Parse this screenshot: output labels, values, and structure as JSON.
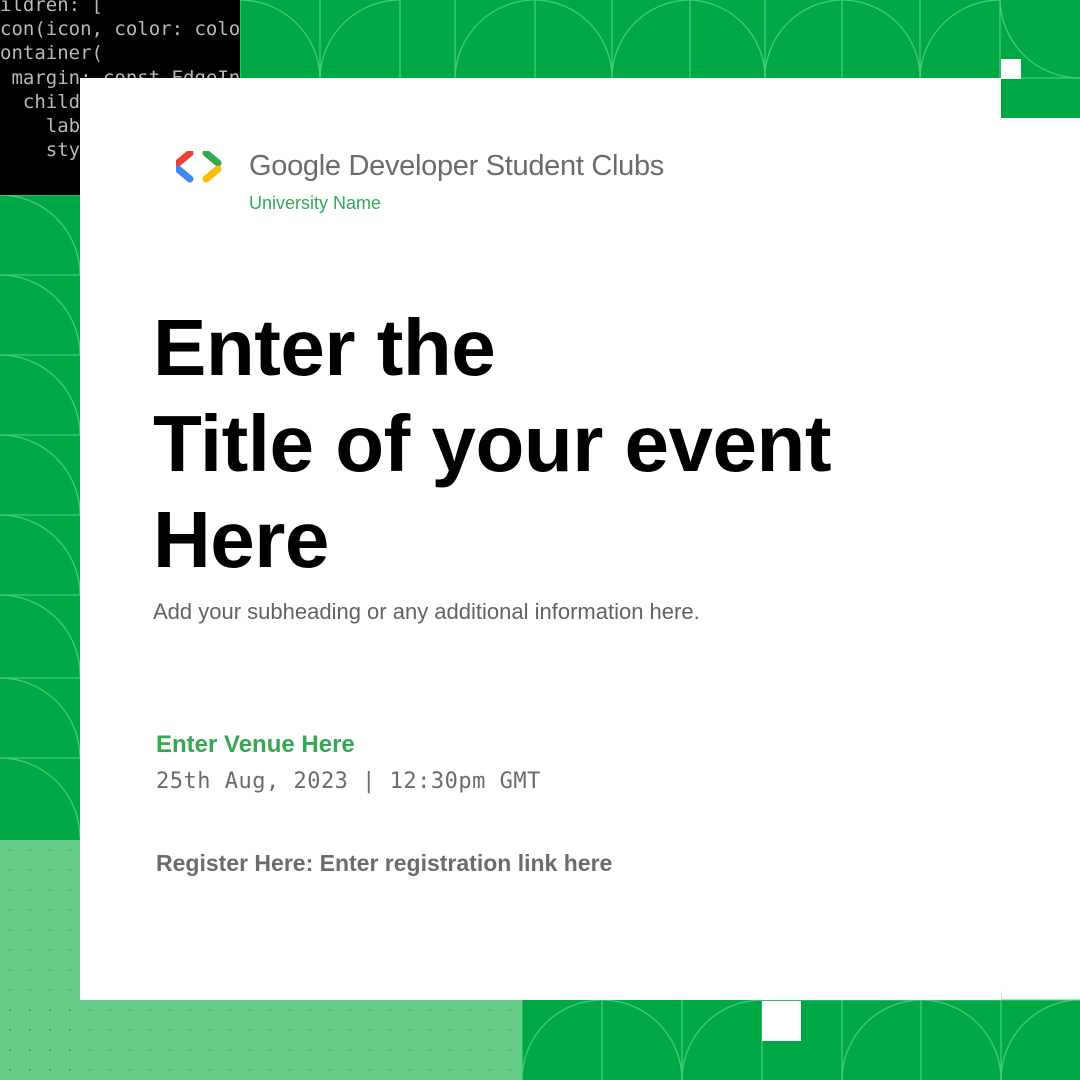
{
  "colors": {
    "brand_green": "#00a745",
    "light_green": "#66cc8a",
    "accent_green": "#34a853",
    "text_black": "#000000",
    "text_gray": "#5f6368",
    "logo_blue": "#4285f4",
    "logo_red": "#ea4335",
    "logo_green": "#34a853",
    "logo_yellow": "#fbbc04"
  },
  "code_snippet": [
    "ildren: [",
    "con(icon, color: color",
    "ontainer(",
    " margin: const EdgeIns",
    "  child:",
    "    label",
    "    style"
  ],
  "logo": {
    "icon": "gdsc-brackets-icon",
    "name": "Google Developer Student Clubs",
    "university": "University Name"
  },
  "event": {
    "title_lines": [
      "Enter the",
      "Title of your event",
      "Here"
    ],
    "subheading": "Add your subheading or any additional information here.",
    "venue": "Enter Venue Here",
    "datetime": "25th Aug, 2023 | 12:30pm GMT",
    "register": "Register Here: Enter registration link here"
  }
}
